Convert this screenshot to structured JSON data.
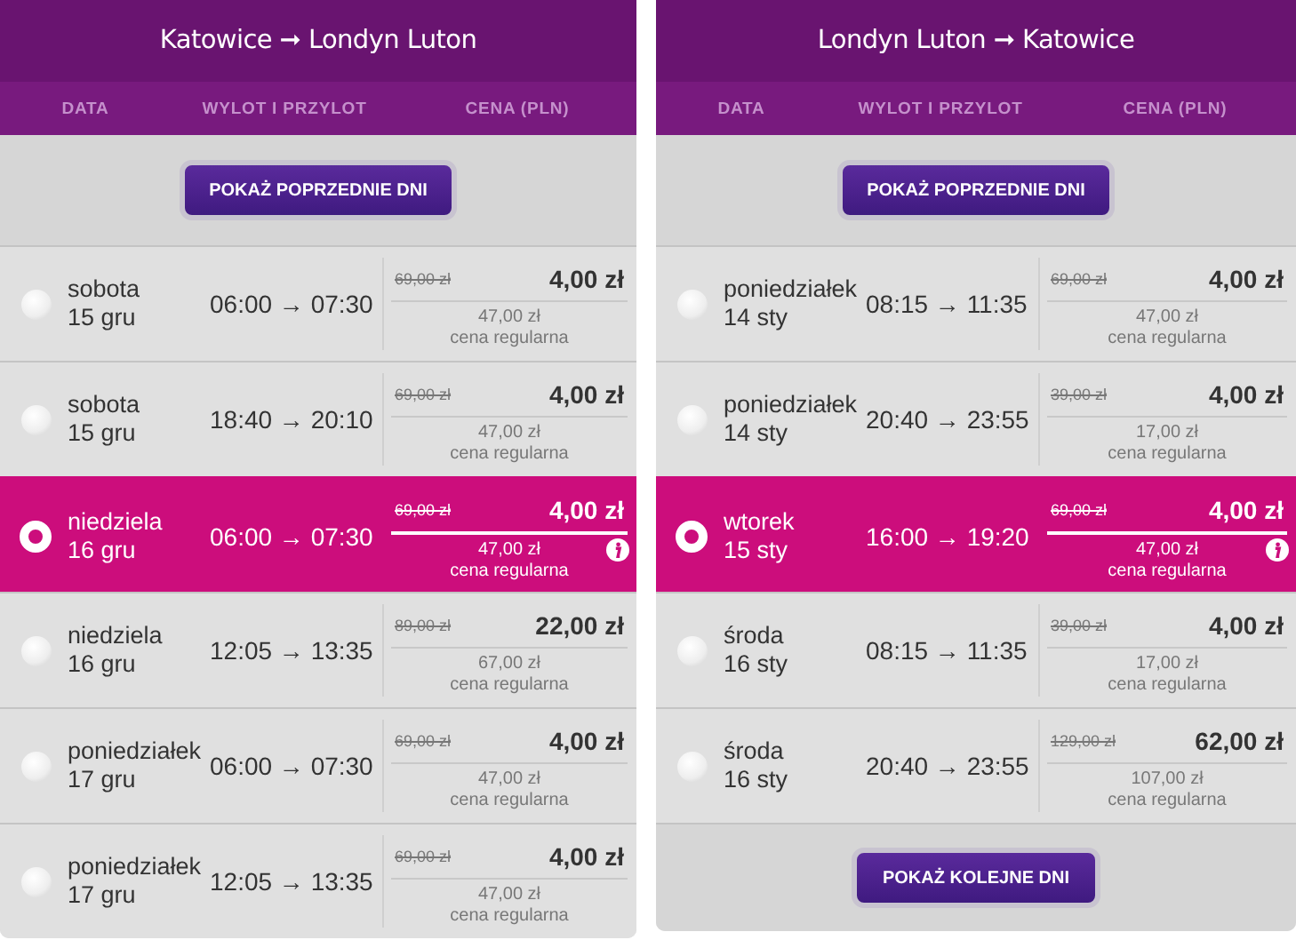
{
  "panels": [
    {
      "title": "Katowice ➞ Londyn Luton",
      "columns": [
        "DATA",
        "WYLOT I PRZYLOT",
        "CENA (PLN)"
      ],
      "prev_button": "POKAŻ POPRZEDNIE DNI",
      "flights": [
        {
          "day": "sobota",
          "date": "15 gru",
          "times": "06:00 → 07:30",
          "old_price": "69,00 zł",
          "price": "4,00 zł",
          "regular_price": "47,00 zł",
          "regular_label": "cena regularna",
          "selected": false
        },
        {
          "day": "sobota",
          "date": "15 gru",
          "times": "18:40 → 20:10",
          "old_price": "69,00 zł",
          "price": "4,00 zł",
          "regular_price": "47,00 zł",
          "regular_label": "cena regularna",
          "selected": false
        },
        {
          "day": "niedziela",
          "date": "16 gru",
          "times": "06:00 → 07:30",
          "old_price": "69,00 zł",
          "price": "4,00 zł",
          "regular_price": "47,00 zł",
          "regular_label": "cena regularna",
          "selected": true
        },
        {
          "day": "niedziela",
          "date": "16 gru",
          "times": "12:05 → 13:35",
          "old_price": "89,00 zł",
          "price": "22,00 zł",
          "regular_price": "67,00 zł",
          "regular_label": "cena regularna",
          "selected": false
        },
        {
          "day": "poniedziałek",
          "date": "17 gru",
          "times": "06:00 → 07:30",
          "old_price": "69,00 zł",
          "price": "4,00 zł",
          "regular_price": "47,00 zł",
          "regular_label": "cena regularna",
          "selected": false
        },
        {
          "day": "poniedziałek",
          "date": "17 gru",
          "times": "12:05 → 13:35",
          "old_price": "69,00 zł",
          "price": "4,00 zł",
          "regular_price": "47,00 zł",
          "regular_label": "cena regularna",
          "selected": false
        }
      ]
    },
    {
      "title": "Londyn Luton ➞ Katowice",
      "columns": [
        "DATA",
        "WYLOT I PRZYLOT",
        "CENA (PLN)"
      ],
      "prev_button": "POKAŻ POPRZEDNIE DNI",
      "flights": [
        {
          "day": "poniedziałek",
          "date": "14 sty",
          "times": "08:15 → 11:35",
          "old_price": "69,00 zł",
          "price": "4,00 zł",
          "regular_price": "47,00 zł",
          "regular_label": "cena regularna",
          "selected": false
        },
        {
          "day": "poniedziałek",
          "date": "14 sty",
          "times": "20:40 → 23:55",
          "old_price": "39,00 zł",
          "price": "4,00 zł",
          "regular_price": "17,00 zł",
          "regular_label": "cena regularna",
          "selected": false
        },
        {
          "day": "wtorek",
          "date": "15 sty",
          "times": "16:00 → 19:20",
          "old_price": "69,00 zł",
          "price": "4,00 zł",
          "regular_price": "47,00 zł",
          "regular_label": "cena regularna",
          "selected": true
        },
        {
          "day": "środa",
          "date": "16 sty",
          "times": "08:15 → 11:35",
          "old_price": "39,00 zł",
          "price": "4,00 zł",
          "regular_price": "17,00 zł",
          "regular_label": "cena regularna",
          "selected": false
        },
        {
          "day": "środa",
          "date": "16 sty",
          "times": "20:40 → 23:55",
          "old_price": "129,00 zł",
          "price": "62,00 zł",
          "regular_price": "107,00 zł",
          "regular_label": "cena regularna",
          "selected": false
        }
      ],
      "next_button": "POKAŻ KOLEJNE DNI"
    }
  ]
}
